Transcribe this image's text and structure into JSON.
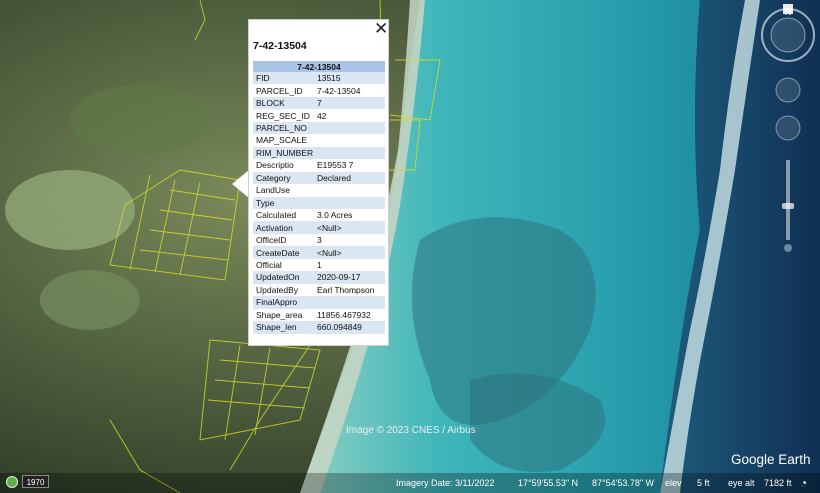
{
  "popup": {
    "title": "7-42-13504",
    "table_header": "7-42-13504",
    "close_icon": "close-icon",
    "rows": [
      {
        "key": "FID",
        "value": "13515"
      },
      {
        "key": "PARCEL_ID",
        "value": "7-42-13504"
      },
      {
        "key": "BLOCK",
        "value": "7"
      },
      {
        "key": "REG_SEC_ID",
        "value": "42"
      },
      {
        "key": "PARCEL_NO",
        "value": ""
      },
      {
        "key": "MAP_SCALE",
        "value": ""
      },
      {
        "key": "RIM_NUMBER",
        "value": ""
      },
      {
        "key": "Descriptio",
        "value": "E19553 7"
      },
      {
        "key": "Category",
        "value": "Declared"
      },
      {
        "key": "LandUse",
        "value": ""
      },
      {
        "key": "Type",
        "value": ""
      },
      {
        "key": "Calculated",
        "value": "3.0 Acres"
      },
      {
        "key": "Activation",
        "value": "<Null>"
      },
      {
        "key": "OfficeID",
        "value": "3"
      },
      {
        "key": "CreateDate",
        "value": "<Null>"
      },
      {
        "key": "Official",
        "value": "1"
      },
      {
        "key": "UpdatedOn",
        "value": "2020-09-17"
      },
      {
        "key": "UpdatedBy",
        "value": "Earl Thompson"
      },
      {
        "key": "FinalAppro",
        "value": ""
      },
      {
        "key": "Shape_area",
        "value": "11856.467932"
      },
      {
        "key": "Shape_len",
        "value": "660.094849"
      }
    ]
  },
  "imagery_credit": "Image © 2023 CNES / Airbus",
  "logo": "Google Earth",
  "status_bar": {
    "historical_year": "1970",
    "imagery_date": "Imagery Date: 3/11/2022",
    "latitude": "17°59'55.53\" N",
    "longitude": "87°54'53.78\" W",
    "elev_label": "elev",
    "elev_value": "5 ft",
    "eye_alt_label": "eye alt",
    "eye_alt_value": "7182 ft"
  },
  "icons": {
    "north": "N",
    "compass": "compass-icon",
    "streaming": "loading-icon"
  }
}
